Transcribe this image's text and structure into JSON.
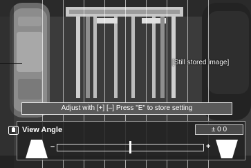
{
  "overlay": {
    "still_image_label": "[Still stored image]"
  },
  "hint": {
    "text": "Adjust with [+] [–]    Press \"E\" to store setting"
  },
  "panel": {
    "icon": "camera-icon",
    "label": "View Angle",
    "value_display": "± 0 0",
    "minus_symbol": "–",
    "plus_symbol": "+",
    "narrow_icon": "narrow-view-angle-icon",
    "wide_icon": "wide-view-angle-icon",
    "slider_position_percent": 50
  }
}
